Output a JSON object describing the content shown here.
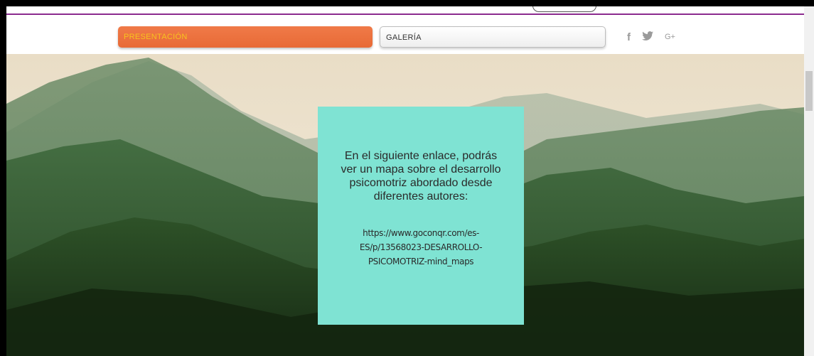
{
  "nav": {
    "items": [
      {
        "label": "PRESENTACIÓN"
      },
      {
        "label": "GALERÍA"
      }
    ]
  },
  "social": {
    "facebook": "f",
    "twitter": "🐦",
    "googleplus": "G+"
  },
  "content": {
    "intro": "En el siguiente enlace, podrás ver un mapa sobre el desarrollo psicomotriz abordado desde diferentes autores:",
    "link": "https://www.goconqr.com/es-ES/p/13568023-DESARROLLO-PSICOMOTRIZ-mind_maps"
  },
  "colors": {
    "accent_orange": "#e86a36",
    "accent_text": "#f7c21e",
    "divider": "#8b2b8f",
    "box": "#7fe3d3"
  }
}
